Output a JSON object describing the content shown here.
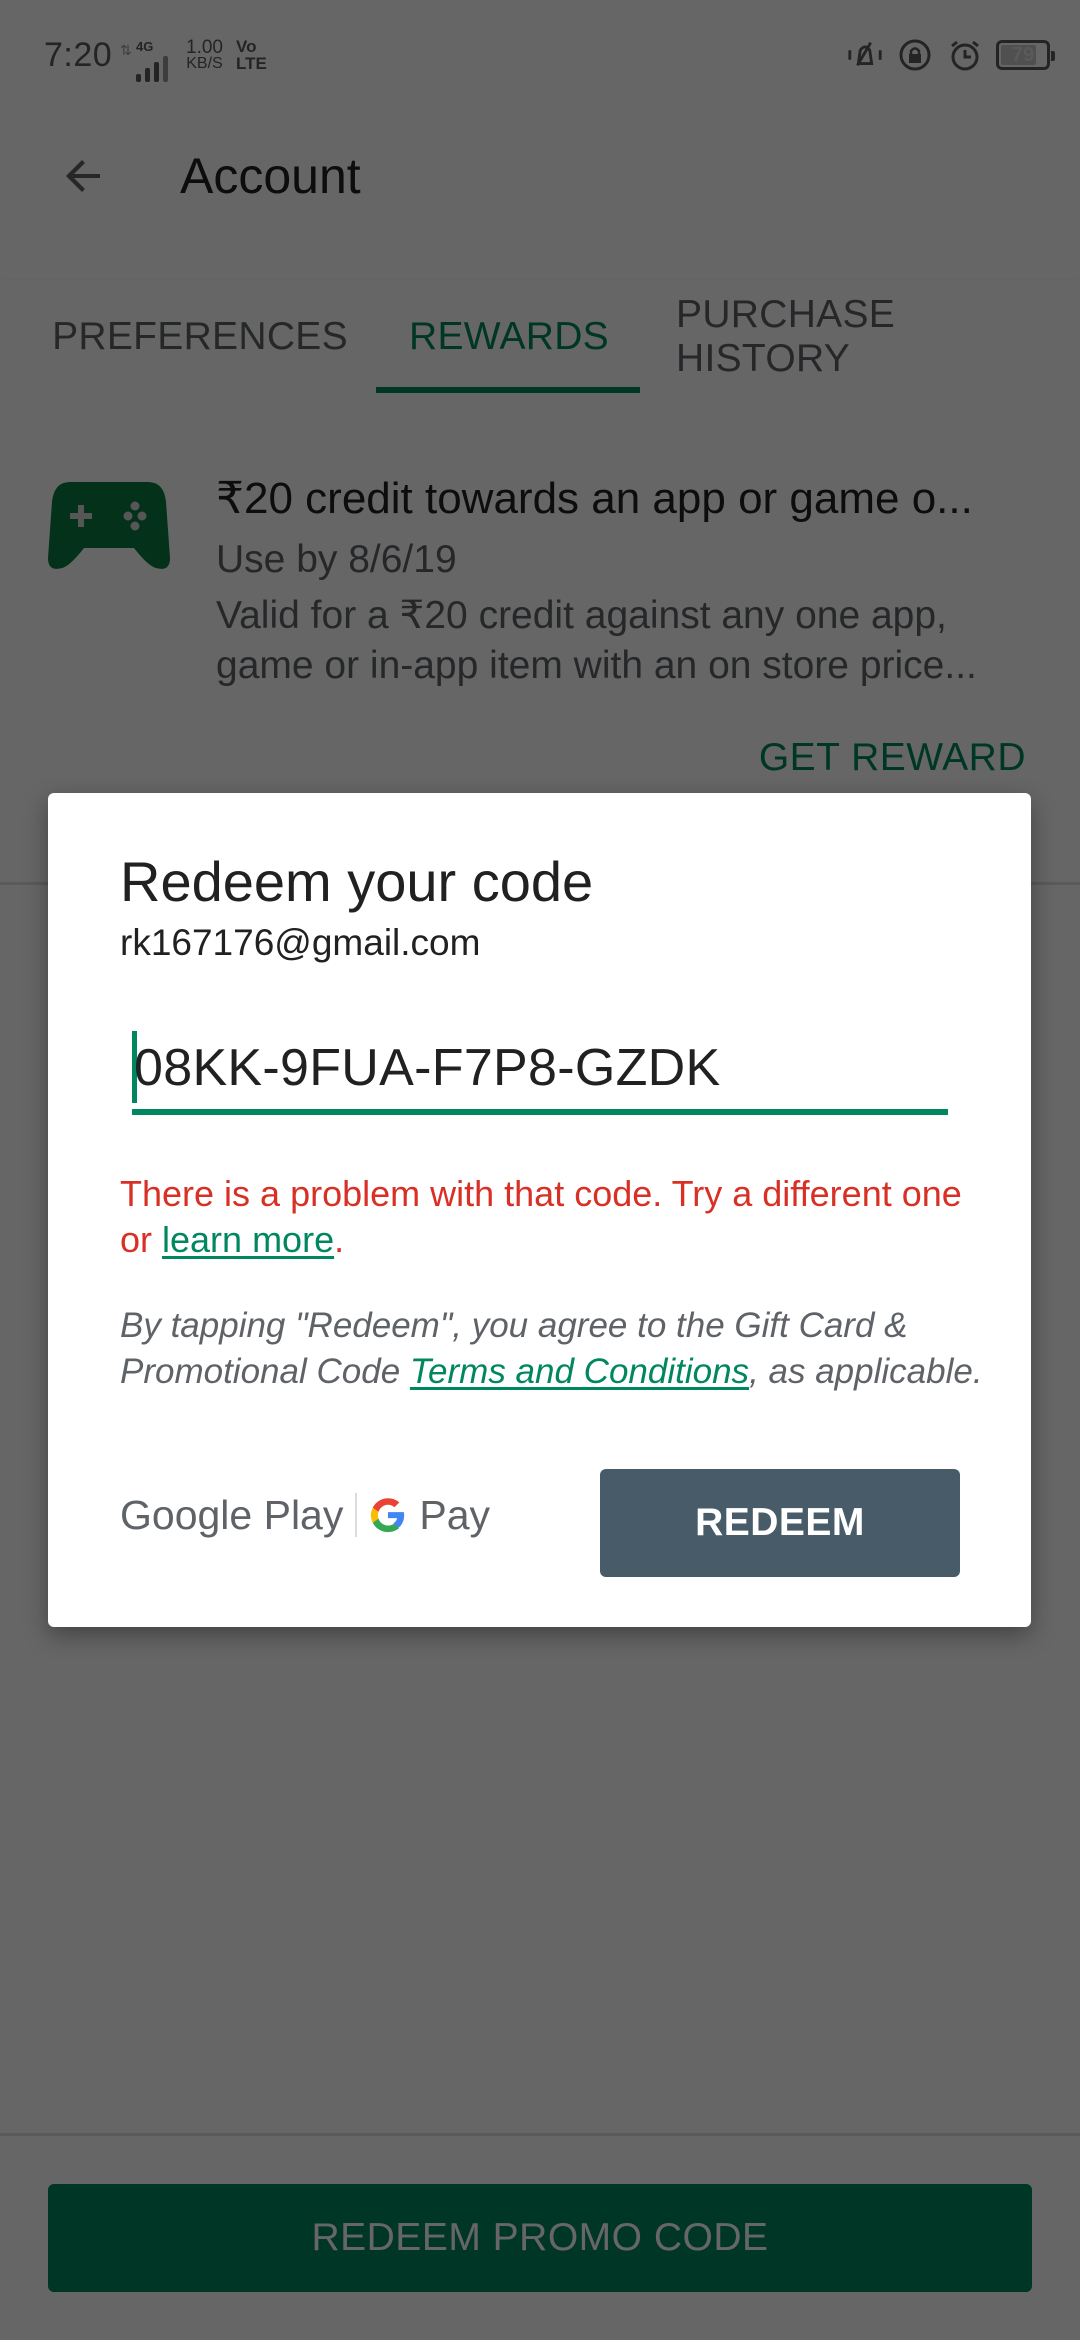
{
  "status_bar": {
    "time": "7:20",
    "network_type": "4G",
    "data_speed_value": "1.00",
    "data_speed_unit": "KB/S",
    "volte_top": "Vo",
    "volte_bottom": "LTE",
    "battery_level": "79",
    "battery_fraction": 0.79,
    "icons": [
      "vibrate-silent-icon",
      "rotation-lock-icon",
      "alarm-icon",
      "battery-icon"
    ]
  },
  "app_bar": {
    "back_icon": "arrow-back-icon",
    "title": "Account"
  },
  "tabs": [
    {
      "label": "PREFERENCES",
      "active": false
    },
    {
      "label": "REWARDS",
      "active": true
    },
    {
      "label": "PURCHASE HISTORY",
      "active": false
    }
  ],
  "reward": {
    "icon": "gamepad-icon",
    "title": "₹20 credit towards an app or game o...",
    "subtitle": "Use by 8/6/19",
    "description": "Valid for a ₹20 credit against any one app, game or in-app item with an on store price...",
    "action_label": "GET REWARD"
  },
  "bottom": {
    "promo_button_label": "REDEEM PROMO CODE"
  },
  "dialog": {
    "title": "Redeem your code",
    "account_email": "rk167176@gmail.com",
    "code_value": "08KK-9FUA-F7P8-GZDK",
    "error_prefix": "There is a problem with that code. Try a different one or ",
    "error_link": "learn more",
    "error_suffix": ".",
    "terms_prefix": "By tapping \"Redeem\", you agree to the Gift Card & Promotional Code ",
    "terms_link": "Terms and Conditions",
    "terms_suffix": ", as applicable.",
    "logo_google_play": "Google Play",
    "logo_pay": "Pay",
    "redeem_label": "REDEEM"
  },
  "colors": {
    "accent_green": "#01875f",
    "error_red": "#d93025",
    "redeem_button": "#485b68",
    "scrim": "rgba(0,0,0,0.6)"
  }
}
